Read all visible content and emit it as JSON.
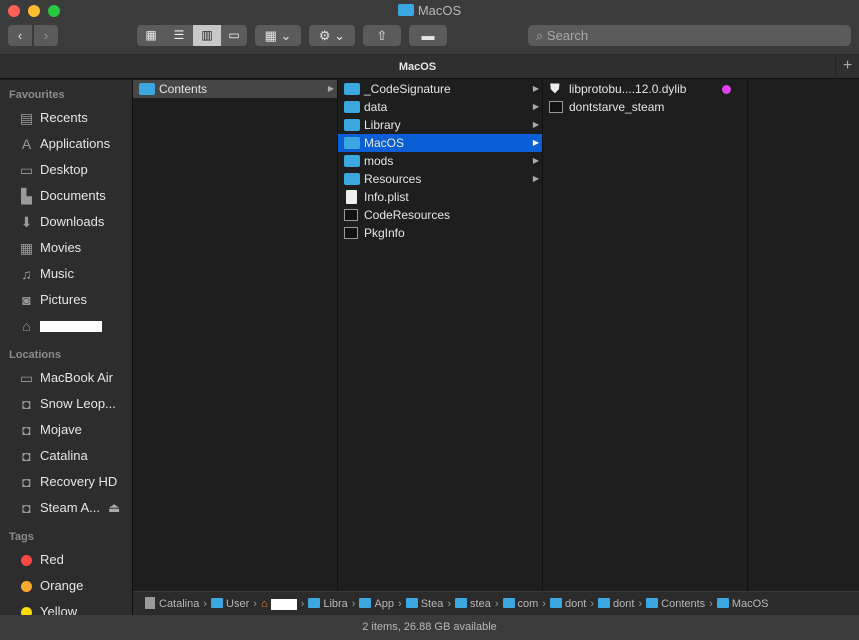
{
  "window": {
    "title": "MacOS",
    "tab_title": "MacOS",
    "search_placeholder": "Search",
    "new_tab": "+"
  },
  "toolbar": {
    "back": "‹",
    "forward": "›"
  },
  "sidebar": {
    "favourites_header": "Favourites",
    "favourites": [
      {
        "label": "Recents",
        "icon": "recents-icon"
      },
      {
        "label": "Applications",
        "icon": "applications-icon"
      },
      {
        "label": "Desktop",
        "icon": "desktop-icon"
      },
      {
        "label": "Documents",
        "icon": "documents-icon"
      },
      {
        "label": "Downloads",
        "icon": "downloads-icon"
      },
      {
        "label": "Movies",
        "icon": "movies-icon"
      },
      {
        "label": "Music",
        "icon": "music-icon"
      },
      {
        "label": "Pictures",
        "icon": "pictures-icon"
      }
    ],
    "locations_header": "Locations",
    "locations": [
      "MacBook Air",
      "Snow Leop...",
      "Mojave",
      "Catalina",
      "Recovery HD",
      "Steam A..."
    ],
    "tags_header": "Tags",
    "tags": [
      {
        "label": "Red",
        "color": "#fe4a49"
      },
      {
        "label": "Orange",
        "color": "#fea82f"
      },
      {
        "label": "Yellow",
        "color": "#fedb00"
      }
    ]
  },
  "columns": {
    "col1": [
      "Contents"
    ],
    "col2": [
      {
        "name": "_CodeSignature",
        "type": "folder"
      },
      {
        "name": "data",
        "type": "folder"
      },
      {
        "name": "Library",
        "type": "folder"
      },
      {
        "name": "MacOS",
        "type": "folder"
      },
      {
        "name": "mods",
        "type": "folder"
      },
      {
        "name": "Resources",
        "type": "folder"
      },
      {
        "name": "Info.plist",
        "type": "doc"
      },
      {
        "name": "CodeResources",
        "type": "exe"
      },
      {
        "name": "PkgInfo",
        "type": "exe"
      }
    ],
    "col3": [
      {
        "name": "libprotobu....12.0.dylib",
        "tag": "#e040f0"
      },
      {
        "name": "dontstarve_steam"
      }
    ]
  },
  "pathbar": [
    "Catalina",
    "User",
    "Libra",
    "App",
    "Stea",
    "stea",
    "com",
    "dont",
    "dont",
    "Contents",
    "MacOS"
  ],
  "status": "2 items, 26.88 GB available",
  "colors": {
    "accent": "#0a5fd6",
    "folder": "#3aa7e0"
  }
}
